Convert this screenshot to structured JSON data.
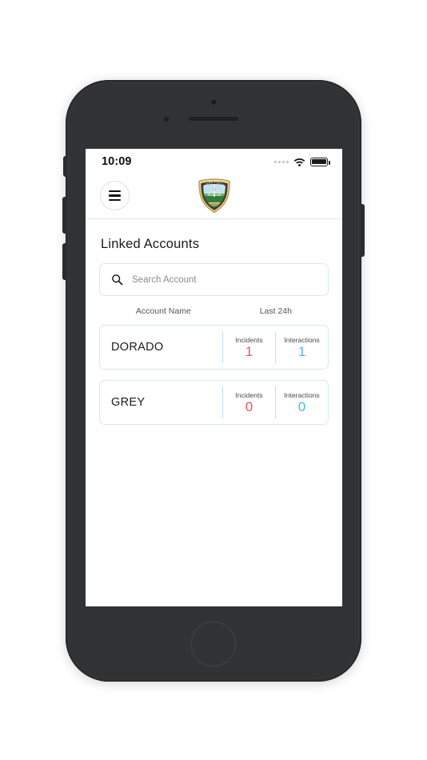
{
  "status_bar": {
    "time": "10:09",
    "signal_icon": "signal-dots-icon",
    "wifi_icon": "wifi-icon",
    "battery_icon": "battery-full-icon"
  },
  "app_bar": {
    "menu_icon": "hamburger-menu-icon",
    "logo_name": "cuerpo-policial-aruba-badge",
    "logo_text_top": "CUERPO POLICIAL",
    "logo_text_bottom": "ARUBA"
  },
  "page": {
    "title": "Linked Accounts"
  },
  "search": {
    "icon": "search-icon",
    "placeholder": "Search Account",
    "value": ""
  },
  "table": {
    "headers": {
      "account_name": "Account Name",
      "last_24h": "Last 24h"
    },
    "stat_labels": {
      "incidents": "Incidents",
      "interactions": "Interactions"
    },
    "rows": [
      {
        "name": "DORADO",
        "incidents": "1",
        "interactions": "1"
      },
      {
        "name": "GREY",
        "incidents": "0",
        "interactions": "0"
      }
    ]
  },
  "colors": {
    "incidents": "#e8565a",
    "interactions": "#4db8e8",
    "border_blue": "#d9e8f3",
    "divider_blue": "#bfdff2",
    "phone_body": "#2e2f31",
    "badge_gold": "#c8a94b"
  }
}
